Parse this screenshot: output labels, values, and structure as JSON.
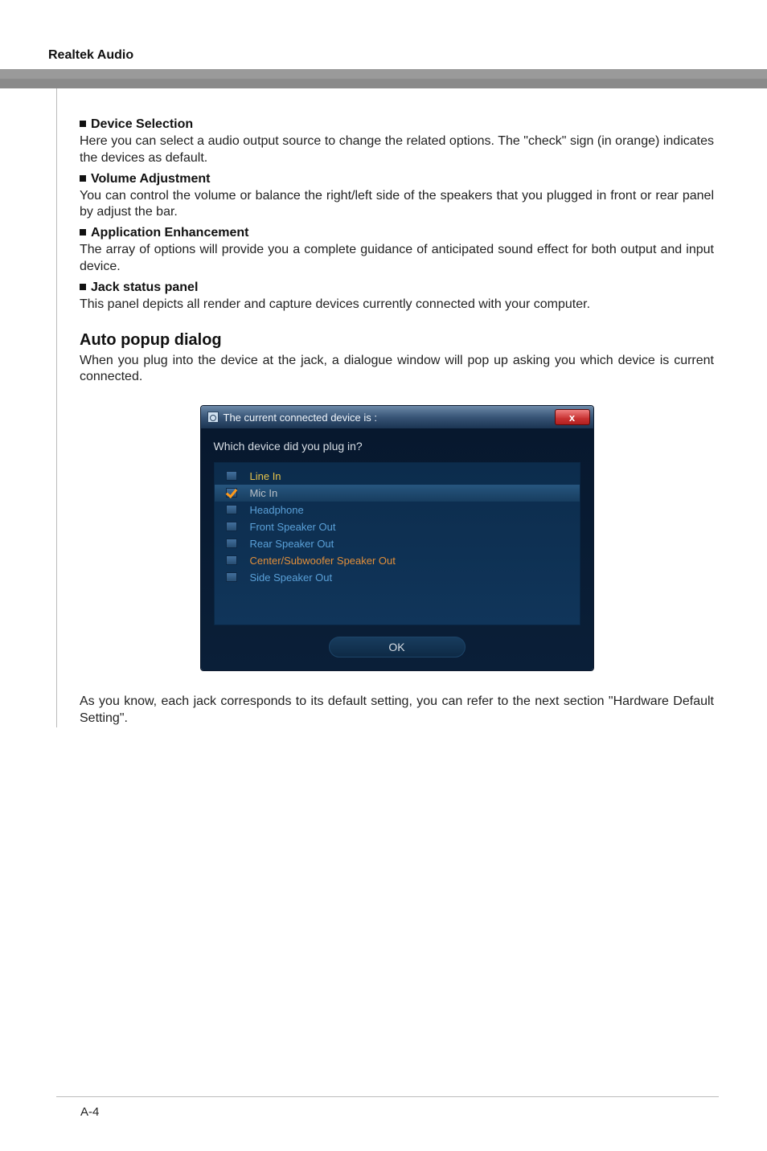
{
  "header": {
    "title": "Realtek Audio"
  },
  "sections": {
    "device_selection": {
      "heading": "Device Selection",
      "text": "Here you can select a audio output source to change the related options. The \"check\" sign (in orange) indicates the devices as default."
    },
    "volume_adjustment": {
      "heading": "Volume Adjustment",
      "text": "You can control the volume or balance the right/left side of the speakers that you plugged in front or rear panel by adjust the bar."
    },
    "application_enhancement": {
      "heading": "Application Enhancement",
      "text": "The array of options will provide you a complete guidance of anticipated sound effect for both output and input device."
    },
    "jack_status": {
      "heading": "Jack status panel",
      "text": "This panel depicts all render and capture devices currently connected with your computer."
    },
    "auto_popup": {
      "heading": "Auto popup dialog",
      "intro": "When you plug into the device at the jack, a dialogue window will pop up asking you which device is current connected.",
      "outro": "As you know, each jack corresponds to its default setting, you can refer to the next section \"Hardware Default Setting\"."
    }
  },
  "dialog": {
    "title": "The current connected device is :",
    "close_label": "x",
    "question": "Which device did you plug in?",
    "items": [
      {
        "label": "Line In",
        "checked": false,
        "selected": false,
        "color": "c-yellow"
      },
      {
        "label": "Mic In",
        "checked": true,
        "selected": true,
        "color": "c-gray"
      },
      {
        "label": "Headphone",
        "checked": false,
        "selected": false,
        "color": "c-blue"
      },
      {
        "label": "Front Speaker Out",
        "checked": false,
        "selected": false,
        "color": "c-blue"
      },
      {
        "label": "Rear Speaker Out",
        "checked": false,
        "selected": false,
        "color": "c-blue"
      },
      {
        "label": "Center/Subwoofer Speaker Out",
        "checked": false,
        "selected": false,
        "color": "c-orange"
      },
      {
        "label": "Side Speaker Out",
        "checked": false,
        "selected": false,
        "color": "c-blue"
      }
    ],
    "ok_label": "OK"
  },
  "footer": {
    "page": "A-4"
  }
}
